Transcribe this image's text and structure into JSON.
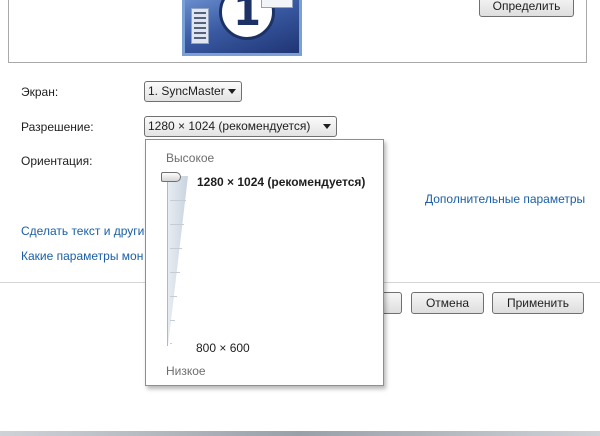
{
  "identify_button": "Определить",
  "monitor_number": "1",
  "display": {
    "label": "Экран:",
    "value": "1. SyncMaster"
  },
  "resolution": {
    "label": "Разрешение:",
    "value": "1280 × 1024 (рекомендуется)"
  },
  "orientation": {
    "label": "Ориентация:"
  },
  "advanced_link": "Дополнительные параметры",
  "links": {
    "text_size": "Сделать текст и другие",
    "which_settings": "Какие параметры мон"
  },
  "resolution_popup": {
    "high_label": "Высокое",
    "low_label": "Низкое",
    "current_option": "1280 × 1024 (рекомендуется)",
    "min_option": "800 × 600",
    "slider_level": 1.0
  },
  "buttons": {
    "cancel": "Отмена",
    "apply": "Применить"
  }
}
